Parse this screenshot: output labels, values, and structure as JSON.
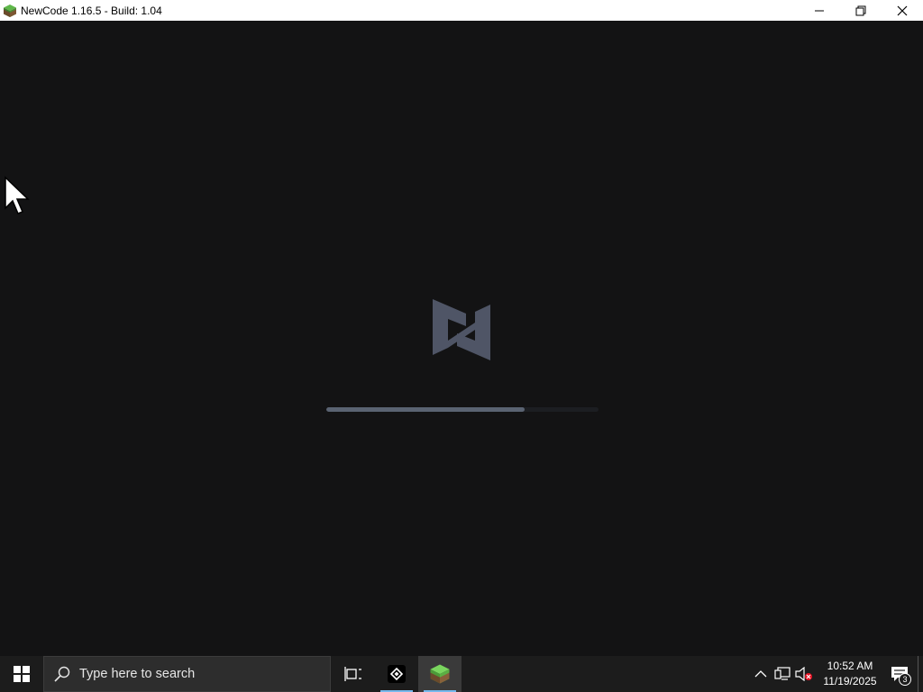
{
  "window": {
    "title": "NewCode 1.16.5 - Build: 1.04",
    "app_icon": "grass-block-icon",
    "controls": [
      "minimize-icon",
      "restore-icon",
      "close-icon"
    ]
  },
  "loading": {
    "logo": "newcode-logo",
    "progress": 0.73,
    "colors": {
      "background": "#131314",
      "logo": "#4f5566",
      "bar_fill": "#5a6372",
      "bar_track": "#1c1e22"
    }
  },
  "taskbar": {
    "start_icon": "windows-icon",
    "search": {
      "placeholder": "Type here to search",
      "icon": "search-icon"
    },
    "apps": [
      {
        "name": "task-view",
        "icon": "task-view-icon"
      },
      {
        "name": "launcher",
        "icon": "launcher-icon"
      },
      {
        "name": "newcode",
        "icon": "grass-block-icon"
      }
    ],
    "tray": {
      "icons": [
        "chevron-up-icon",
        "network-icon",
        "volume-muted-icon"
      ],
      "time": "10:52 AM",
      "date": "11/19/2025",
      "notification_count": "3"
    }
  }
}
